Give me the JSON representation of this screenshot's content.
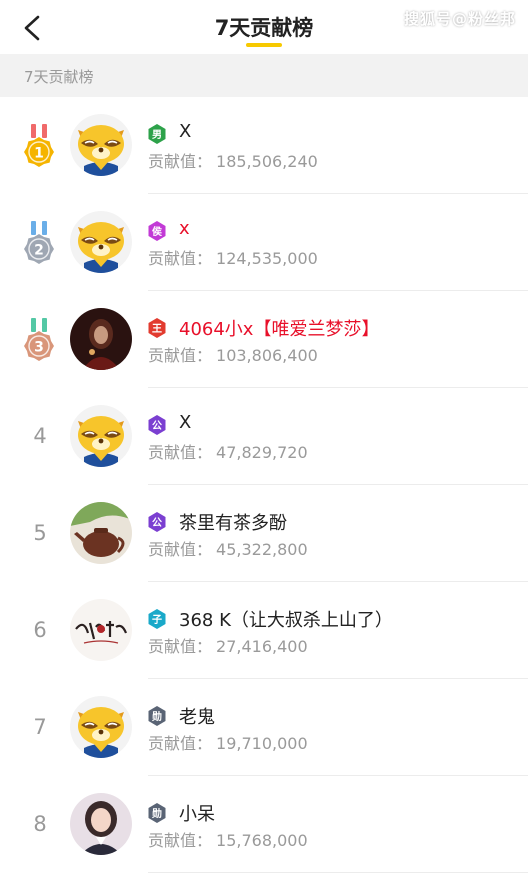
{
  "header": {
    "title": "7天贡献榜",
    "watermark": "搜狐号@粉丝邦"
  },
  "section": {
    "label": "7天贡献榜"
  },
  "contrib_label": "贡献值：",
  "entries": [
    {
      "rank": "1",
      "badge": "男",
      "badge_color": "#2da24a",
      "name": "X",
      "name_color": "#222222",
      "value": "185,506,240",
      "avatar": "mascot"
    },
    {
      "rank": "2",
      "badge": "侯",
      "badge_color": "#c23ad6",
      "name": "x",
      "name_color": "#e8102a",
      "value": "124,535,000",
      "avatar": "mascot"
    },
    {
      "rank": "3",
      "badge": "王",
      "badge_color": "#e23b2f",
      "name": "4064小x【唯爱兰梦莎】",
      "name_color": "#e8102a",
      "value": "103,806,400",
      "avatar": "dark-photo"
    },
    {
      "rank": "4",
      "badge": "公",
      "badge_color": "#7b3fd1",
      "name": "X",
      "name_color": "#222222",
      "value": "47,829,720",
      "avatar": "mascot"
    },
    {
      "rank": "5",
      "badge": "公",
      "badge_color": "#7b3fd1",
      "name": "茶里有茶多酚",
      "name_color": "#222222",
      "value": "45,322,800",
      "avatar": "teapot-photo"
    },
    {
      "rank": "6",
      "badge": "子",
      "badge_color": "#1aa9c9",
      "name": "368 K（让大叔杀上山了）",
      "name_color": "#222222",
      "value": "27,416,400",
      "avatar": "calligraphy"
    },
    {
      "rank": "7",
      "badge": "勋",
      "badge_color": "#5a6475",
      "name": "老鬼",
      "name_color": "#222222",
      "value": "19,710,000",
      "avatar": "mascot"
    },
    {
      "rank": "8",
      "badge": "勋",
      "badge_color": "#5a6475",
      "name": "小呆",
      "name_color": "#222222",
      "value": "15,768,000",
      "avatar": "girl-photo"
    }
  ],
  "medal_colors": {
    "1": "#f5b400",
    "2": "#9fa7b3",
    "3": "#d9967a"
  },
  "ribbon_colors": {
    "1": "#f06a6a",
    "2": "#6aaee8",
    "3": "#54c8a5"
  }
}
